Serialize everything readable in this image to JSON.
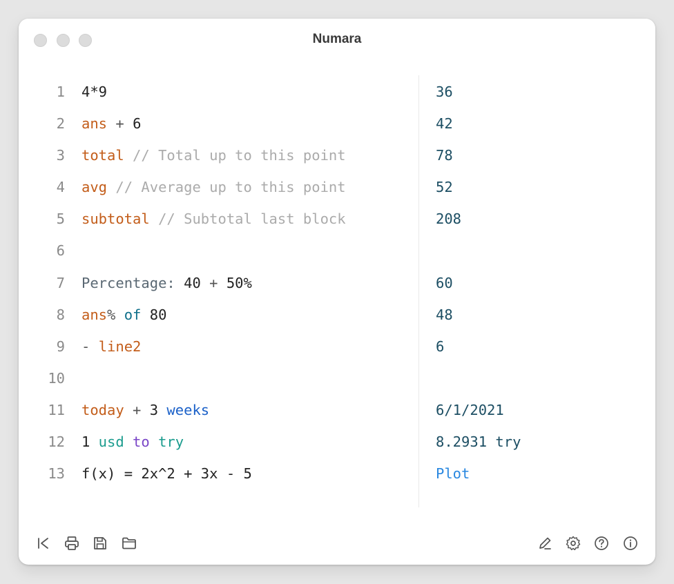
{
  "window": {
    "title": "Numara"
  },
  "lines": [
    {
      "n": "1",
      "tokens": [
        {
          "t": "4*9",
          "c": "c-num"
        }
      ],
      "result": "36",
      "result_class": ""
    },
    {
      "n": "2",
      "tokens": [
        {
          "t": "ans",
          "c": "c-var"
        },
        {
          "t": " + ",
          "c": "c-op"
        },
        {
          "t": "6",
          "c": "c-num"
        }
      ],
      "result": "42",
      "result_class": ""
    },
    {
      "n": "3",
      "tokens": [
        {
          "t": "total",
          "c": "c-var"
        },
        {
          "t": " // Total up to this point",
          "c": "c-cmt"
        }
      ],
      "result": "78",
      "result_class": ""
    },
    {
      "n": "4",
      "tokens": [
        {
          "t": "avg",
          "c": "c-var"
        },
        {
          "t": " // Average up to this point",
          "c": "c-cmt"
        }
      ],
      "result": "52",
      "result_class": ""
    },
    {
      "n": "5",
      "tokens": [
        {
          "t": "subtotal",
          "c": "c-var"
        },
        {
          "t": " // Subtotal last block",
          "c": "c-cmt"
        }
      ],
      "result": "208",
      "result_class": ""
    },
    {
      "n": "6",
      "tokens": [],
      "result": "",
      "result_class": ""
    },
    {
      "n": "7",
      "tokens": [
        {
          "t": "Percentage:",
          "c": "c-label"
        },
        {
          "t": " 40",
          "c": "c-num"
        },
        {
          "t": " + ",
          "c": "c-op"
        },
        {
          "t": "50%",
          "c": "c-num"
        }
      ],
      "result": "60",
      "result_class": ""
    },
    {
      "n": "8",
      "tokens": [
        {
          "t": "ans",
          "c": "c-var"
        },
        {
          "t": "%",
          "c": "c-op"
        },
        {
          "t": " of ",
          "c": "c-kw"
        },
        {
          "t": "80",
          "c": "c-num"
        }
      ],
      "result": "48",
      "result_class": ""
    },
    {
      "n": "9",
      "tokens": [
        {
          "t": "- ",
          "c": "c-op"
        },
        {
          "t": "line2",
          "c": "c-var"
        }
      ],
      "result": "6",
      "result_class": ""
    },
    {
      "n": "10",
      "tokens": [],
      "result": "",
      "result_class": ""
    },
    {
      "n": "11",
      "tokens": [
        {
          "t": "today",
          "c": "c-var"
        },
        {
          "t": " + ",
          "c": "c-op"
        },
        {
          "t": "3",
          "c": "c-num"
        },
        {
          "t": " weeks",
          "c": "c-unit"
        }
      ],
      "result": "6/1/2021",
      "result_class": ""
    },
    {
      "n": "12",
      "tokens": [
        {
          "t": "1",
          "c": "c-num"
        },
        {
          "t": " usd",
          "c": "c-cur"
        },
        {
          "t": " to",
          "c": "c-to"
        },
        {
          "t": " try",
          "c": "c-cur"
        }
      ],
      "result": "8.2931 try",
      "result_class": ""
    },
    {
      "n": "13",
      "tokens": [
        {
          "t": "f(x) = 2x^2 + 3x - 5",
          "c": "c-num"
        }
      ],
      "result": "Plot",
      "result_class": "plot"
    }
  ],
  "toolbar": {
    "left": [
      "clear-icon",
      "print-icon",
      "save-icon",
      "open-folder-icon"
    ],
    "right": [
      "edit-icon",
      "settings-icon",
      "help-icon",
      "info-icon"
    ]
  },
  "colors": {
    "variable": "#c35d1a",
    "comment": "#ababab",
    "result": "#1c4e63",
    "plot_link": "#2a88e0",
    "unit": "#1a60c8",
    "currency": "#1b9c8e",
    "conversion": "#7a46c7"
  }
}
